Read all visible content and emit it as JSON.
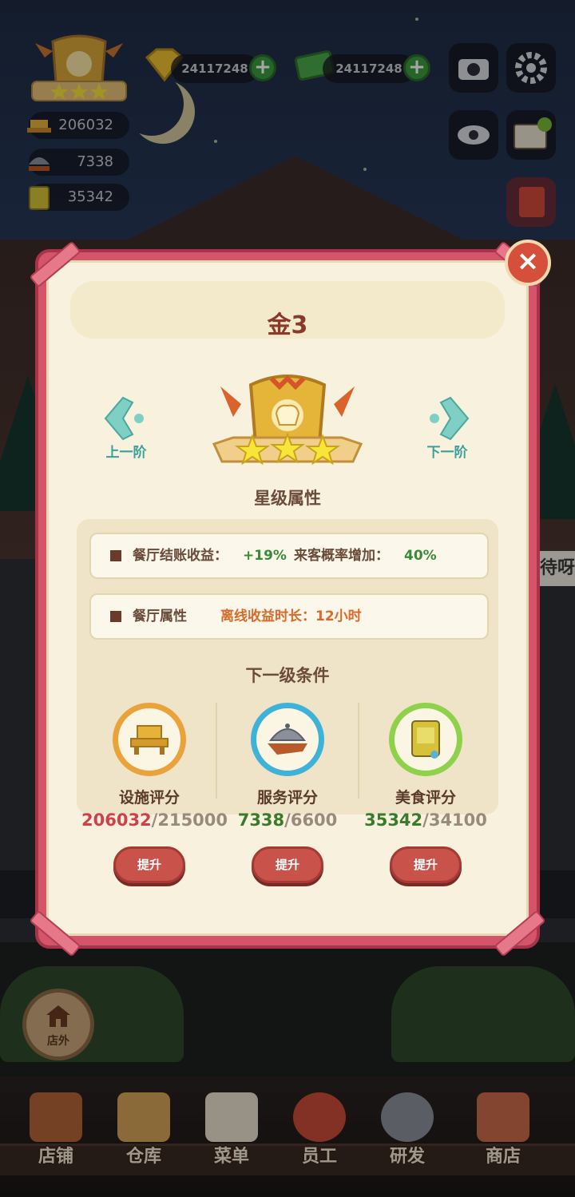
{
  "hud": {
    "gem_currency": "24117248",
    "cash_currency": "24117248",
    "facility_score": "206032",
    "service_score": "7338",
    "food_score": "35342",
    "rank_stars": 3
  },
  "modal": {
    "title": "金3",
    "prev_label": "上一阶",
    "next_label": "下一阶",
    "attributes_title": "星级属性",
    "attr_row1": {
      "label1": "餐厅结账收益：",
      "value1": "+19%",
      "label2": "来客概率增加：",
      "value2": "40%"
    },
    "attr_row2": {
      "label": "餐厅属性",
      "detail": "离线收益时长：12小时"
    },
    "conditions_title": "下一级条件",
    "conditions": [
      {
        "name": "设施评分",
        "current": "206032",
        "target": "/215000",
        "button": "提升",
        "ring_color": "#e9a33a",
        "fraction": 0.958
      },
      {
        "name": "服务评分",
        "current": "7338",
        "target": "/6600",
        "button": "提升",
        "ring_color": "#3fb2d8",
        "fraction": 1.0
      },
      {
        "name": "美食评分",
        "current": "35342",
        "target": "/34100",
        "button": "提升",
        "ring_color": "#8ed14a",
        "fraction": 1.0
      }
    ]
  },
  "outside_button": "店外",
  "bottom_nav": [
    {
      "label": "店铺"
    },
    {
      "label": "仓库"
    },
    {
      "label": "菜单"
    },
    {
      "label": "员工"
    },
    {
      "label": "研发"
    },
    {
      "label": "商店"
    }
  ],
  "side_text": "待呀",
  "colors": {
    "modal_border": "#d4546a",
    "panel_bg": "#f7f1dd",
    "title_color": "#8a3a2a",
    "upgrade_button": "#c9524a"
  }
}
